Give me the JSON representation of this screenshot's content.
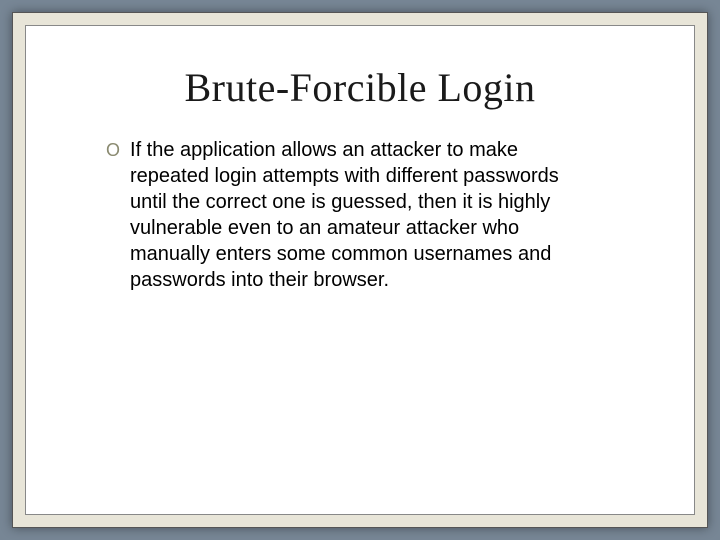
{
  "slide": {
    "title": "Brute-Forcible Login",
    "bullets": [
      {
        "marker": "O",
        "text": "If the application allows an attacker to make repeated login attempts with different passwords until the correct one is guessed, then it is highly vulnerable even to an amateur attacker who manually enters some common usernames and passwords into their browser."
      }
    ]
  }
}
